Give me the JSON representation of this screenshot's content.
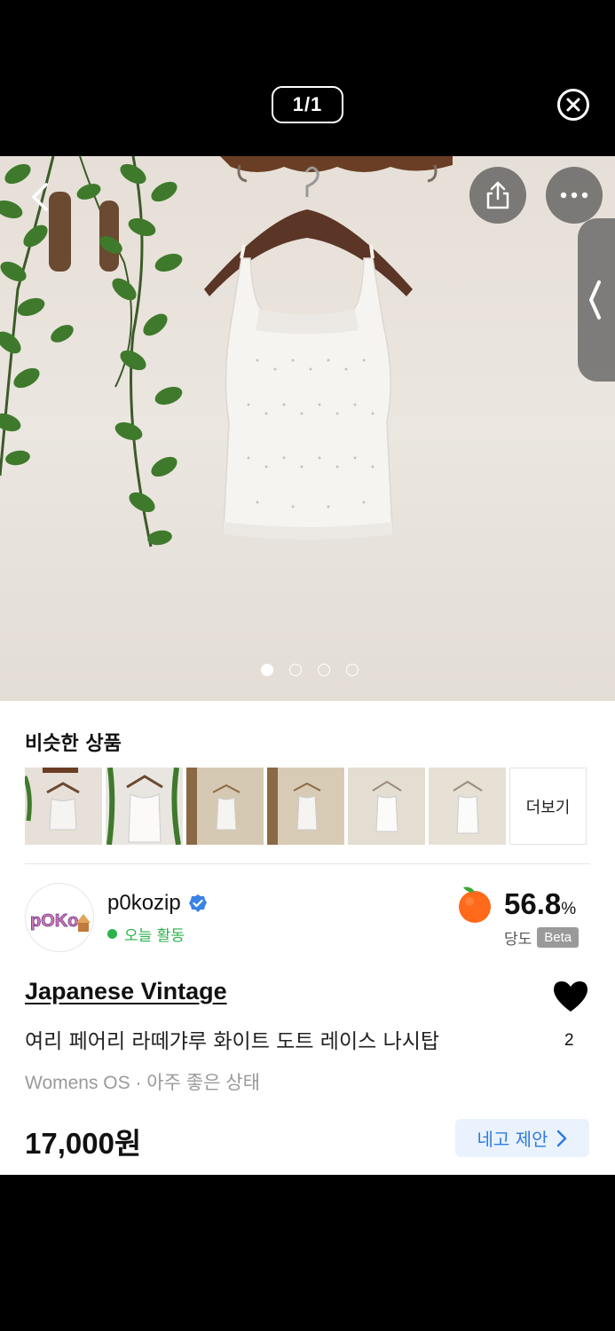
{
  "viewer": {
    "counter": "1/1"
  },
  "carousel": {
    "dots": [
      true,
      false,
      false,
      false
    ]
  },
  "similar": {
    "title": "비슷한 상품",
    "more_label": "더보기",
    "thumbnails": [
      "thumb-1",
      "thumb-2",
      "thumb-3",
      "thumb-4",
      "thumb-5",
      "thumb-6"
    ]
  },
  "seller": {
    "name": "p0kozip",
    "activity": "오늘 활동",
    "avatar_text": "pOKo",
    "score_value": "56.8",
    "score_unit": "%",
    "score_label": "당도",
    "beta": "Beta"
  },
  "product": {
    "brand": "Japanese Vintage",
    "title": "여리 페어리 라떼갸루 화이트 도트 레이스 나시탑",
    "meta": "Womens OS · 아주 좋은 상태",
    "price": "17,000원",
    "likes": "2"
  },
  "actions": {
    "offer_label": "네고 제안"
  },
  "colors": {
    "activity_green": "#2bb24c",
    "offer_blue": "#2e7be0",
    "offer_bg": "#eaf2fd"
  }
}
